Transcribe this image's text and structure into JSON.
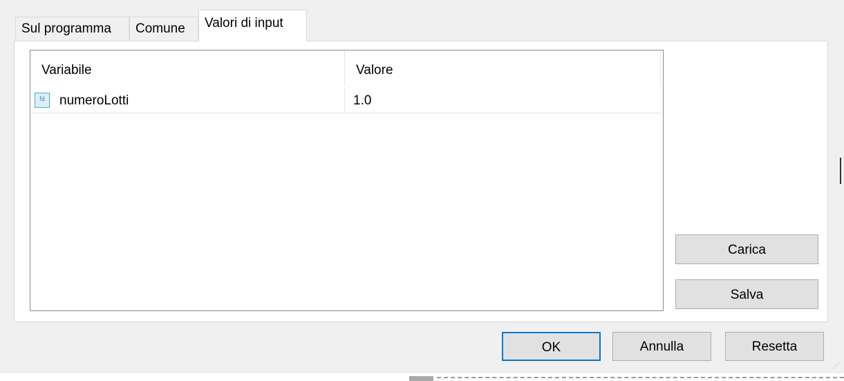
{
  "tabs": [
    {
      "label": "Sul programma",
      "active": false
    },
    {
      "label": "Comune",
      "active": false
    },
    {
      "label": "Valori di input",
      "active": true
    }
  ],
  "list": {
    "columns": [
      "Variabile",
      "Valore"
    ],
    "rows": [
      {
        "icon": "variable-icon",
        "name": "numeroLotti",
        "value": "1.0"
      }
    ]
  },
  "side_buttons": {
    "load": "Carica",
    "save": "Salva"
  },
  "footer_buttons": {
    "ok": "OK",
    "cancel": "Annulla",
    "reset": "Resetta"
  },
  "colors": {
    "focus_border": "#0078d7",
    "dialog_bg": "#f0f0f0"
  }
}
